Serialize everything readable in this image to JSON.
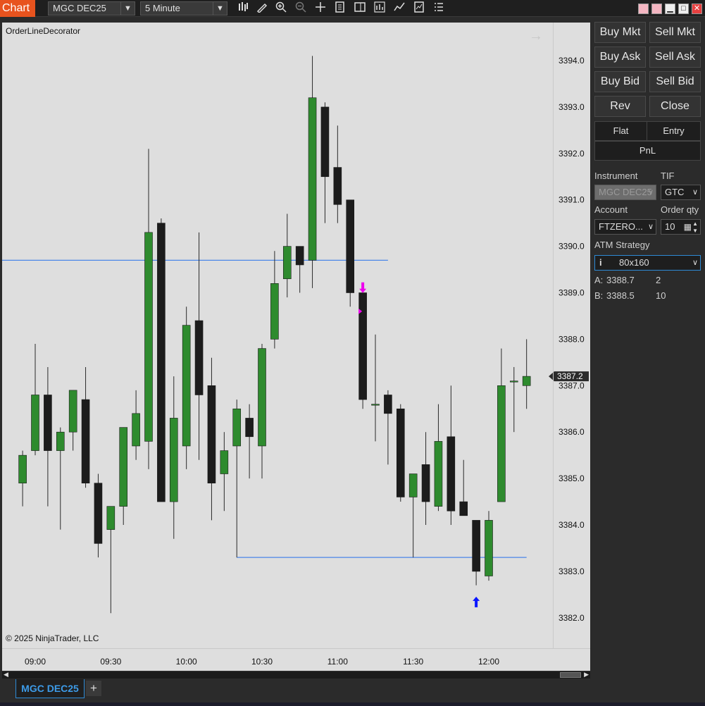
{
  "toolbar": {
    "chart_tab": "Chart",
    "instrument": "MGC DEC25",
    "interval": "5 Minute"
  },
  "chart": {
    "indicator_label": "OrderLineDecorator",
    "copyright": "© 2025 NinjaTrader, LLC",
    "current_price_label": "3387.2",
    "colors": {
      "background": "#dedede",
      "up_candle": "#2e8b2e",
      "down_candle": "#1c1c1c",
      "order_line": "#4a86e8",
      "sell_marker": "#ee00ee",
      "buy_marker": "#0a16ff"
    }
  },
  "chart_data": {
    "type": "candlestick",
    "x_ticks": [
      "09:00",
      "09:30",
      "10:00",
      "10:30",
      "11:00",
      "11:30",
      "12:00"
    ],
    "y_ticks": [
      "3394.0",
      "3393.0",
      "3392.0",
      "3391.0",
      "3390.0",
      "3389.0",
      "3388.0",
      "3387.0",
      "3386.0",
      "3385.0",
      "3384.0",
      "3383.0",
      "3382.0"
    ],
    "ylim": [
      3381.5,
      3394.6
    ],
    "interval_minutes": 5,
    "first_bar": "08:55",
    "order_lines": [
      {
        "price": 3389.7,
        "from": "08:45",
        "to": "11:20"
      },
      {
        "price": 3383.3,
        "from": "10:20",
        "to": "12:15"
      }
    ],
    "markers": [
      {
        "type": "sell-arrow",
        "time": "11:10",
        "price": 3388.95
      },
      {
        "type": "entry-marker",
        "time": "11:10",
        "price": 3388.6
      },
      {
        "type": "buy-arrow",
        "time": "11:55",
        "price": 3382.5
      }
    ],
    "candles": [
      {
        "t": "08:55",
        "o": 3384.9,
        "h": 3385.6,
        "l": 3384.4,
        "c": 3385.5
      },
      {
        "t": "09:00",
        "o": 3385.6,
        "h": 3387.9,
        "l": 3385.5,
        "c": 3386.8
      },
      {
        "t": "09:05",
        "o": 3386.8,
        "h": 3387.4,
        "l": 3384.4,
        "c": 3385.6
      },
      {
        "t": "09:10",
        "o": 3385.6,
        "h": 3386.1,
        "l": 3383.9,
        "c": 3386.0
      },
      {
        "t": "09:15",
        "o": 3386.0,
        "h": 3386.9,
        "l": 3385.6,
        "c": 3386.9
      },
      {
        "t": "09:20",
        "o": 3386.7,
        "h": 3387.4,
        "l": 3384.8,
        "c": 3384.9
      },
      {
        "t": "09:25",
        "o": 3384.9,
        "h": 3385.1,
        "l": 3383.3,
        "c": 3383.6
      },
      {
        "t": "09:30",
        "o": 3383.9,
        "h": 3384.4,
        "l": 3382.1,
        "c": 3384.4
      },
      {
        "t": "09:35",
        "o": 3384.4,
        "h": 3386.1,
        "l": 3384.0,
        "c": 3386.1
      },
      {
        "t": "09:40",
        "o": 3385.7,
        "h": 3386.9,
        "l": 3385.4,
        "c": 3386.4
      },
      {
        "t": "09:45",
        "o": 3385.8,
        "h": 3392.1,
        "l": 3385.2,
        "c": 3390.3
      },
      {
        "t": "09:50",
        "o": 3390.5,
        "h": 3390.6,
        "l": 3384.5,
        "c": 3384.5
      },
      {
        "t": "09:55",
        "o": 3384.5,
        "h": 3387.2,
        "l": 3383.7,
        "c": 3386.3
      },
      {
        "t": "10:00",
        "o": 3385.7,
        "h": 3388.7,
        "l": 3385.2,
        "c": 3388.3
      },
      {
        "t": "10:05",
        "o": 3388.4,
        "h": 3390.3,
        "l": 3385.4,
        "c": 3386.8
      },
      {
        "t": "10:10",
        "o": 3387.0,
        "h": 3387.6,
        "l": 3384.1,
        "c": 3384.9
      },
      {
        "t": "10:15",
        "o": 3385.1,
        "h": 3386.0,
        "l": 3384.3,
        "c": 3385.6
      },
      {
        "t": "10:20",
        "o": 3385.7,
        "h": 3386.7,
        "l": 3383.3,
        "c": 3386.5
      },
      {
        "t": "10:25",
        "o": 3386.3,
        "h": 3386.6,
        "l": 3385.0,
        "c": 3385.9
      },
      {
        "t": "10:30",
        "o": 3385.7,
        "h": 3387.9,
        "l": 3385.0,
        "c": 3387.8
      },
      {
        "t": "10:35",
        "o": 3388.0,
        "h": 3389.9,
        "l": 3387.8,
        "c": 3389.2
      },
      {
        "t": "10:40",
        "o": 3389.3,
        "h": 3390.7,
        "l": 3388.9,
        "c": 3390.0
      },
      {
        "t": "10:45",
        "o": 3390.0,
        "h": 3390.0,
        "l": 3389.0,
        "c": 3389.6
      },
      {
        "t": "10:50",
        "o": 3389.7,
        "h": 3394.1,
        "l": 3389.1,
        "c": 3393.2
      },
      {
        "t": "10:55",
        "o": 3393.0,
        "h": 3393.1,
        "l": 3390.5,
        "c": 3391.5
      },
      {
        "t": "11:00",
        "o": 3391.7,
        "h": 3392.6,
        "l": 3390.5,
        "c": 3390.9
      },
      {
        "t": "11:05",
        "o": 3391.0,
        "h": 3391.0,
        "l": 3388.7,
        "c": 3389.0
      },
      {
        "t": "11:10",
        "o": 3389.0,
        "h": 3389.2,
        "l": 3386.5,
        "c": 3386.7
      },
      {
        "t": "11:15",
        "o": 3386.6,
        "h": 3388.1,
        "l": 3385.8,
        "c": 3386.6
      },
      {
        "t": "11:20",
        "o": 3386.8,
        "h": 3386.9,
        "l": 3385.3,
        "c": 3386.4
      },
      {
        "t": "11:25",
        "o": 3386.5,
        "h": 3386.6,
        "l": 3384.5,
        "c": 3384.6
      },
      {
        "t": "11:30",
        "o": 3384.6,
        "h": 3385.1,
        "l": 3383.3,
        "c": 3385.1
      },
      {
        "t": "11:35",
        "o": 3385.3,
        "h": 3386.0,
        "l": 3384.0,
        "c": 3384.5
      },
      {
        "t": "11:40",
        "o": 3384.4,
        "h": 3386.6,
        "l": 3384.3,
        "c": 3385.8
      },
      {
        "t": "11:45",
        "o": 3385.9,
        "h": 3387.0,
        "l": 3384.0,
        "c": 3384.3
      },
      {
        "t": "11:50",
        "o": 3384.5,
        "h": 3385.4,
        "l": 3384.2,
        "c": 3384.2
      },
      {
        "t": "11:55",
        "o": 3384.1,
        "h": 3384.1,
        "l": 3382.7,
        "c": 3383.0
      },
      {
        "t": "12:00",
        "o": 3382.9,
        "h": 3384.3,
        "l": 3382.8,
        "c": 3384.1
      },
      {
        "t": "12:05",
        "o": 3384.5,
        "h": 3387.8,
        "l": 3384.5,
        "c": 3387.0
      },
      {
        "t": "12:10",
        "o": 3387.1,
        "h": 3387.4,
        "l": 3386.0,
        "c": 3387.1
      },
      {
        "t": "12:15",
        "o": 3387.0,
        "h": 3388.0,
        "l": 3386.5,
        "c": 3387.2
      }
    ]
  },
  "order_panel": {
    "buttons": {
      "buy_mkt": "Buy Mkt",
      "sell_mkt": "Sell Mkt",
      "buy_ask": "Buy Ask",
      "sell_ask": "Sell Ask",
      "buy_bid": "Buy Bid",
      "sell_bid": "Sell Bid",
      "rev": "Rev",
      "close": "Close"
    },
    "position": {
      "flat": "Flat",
      "entry": "Entry",
      "pnl": "PnL"
    },
    "instrument_label": "Instrument",
    "instrument_value": "MGC DEC25",
    "tif_label": "TIF",
    "tif_value": "GTC",
    "account_label": "Account",
    "account_value": "FTZERO...",
    "order_qty_label": "Order qty",
    "order_qty_value": "10",
    "atm_label": "ATM Strategy",
    "atm_value": "80x160",
    "ask_label": "A:",
    "ask_price": "3388.7",
    "ask_size": "2",
    "bid_label": "B:",
    "bid_price": "3388.5",
    "bid_size": "10"
  },
  "tabs": {
    "active": "MGC DEC25",
    "add": "+"
  }
}
